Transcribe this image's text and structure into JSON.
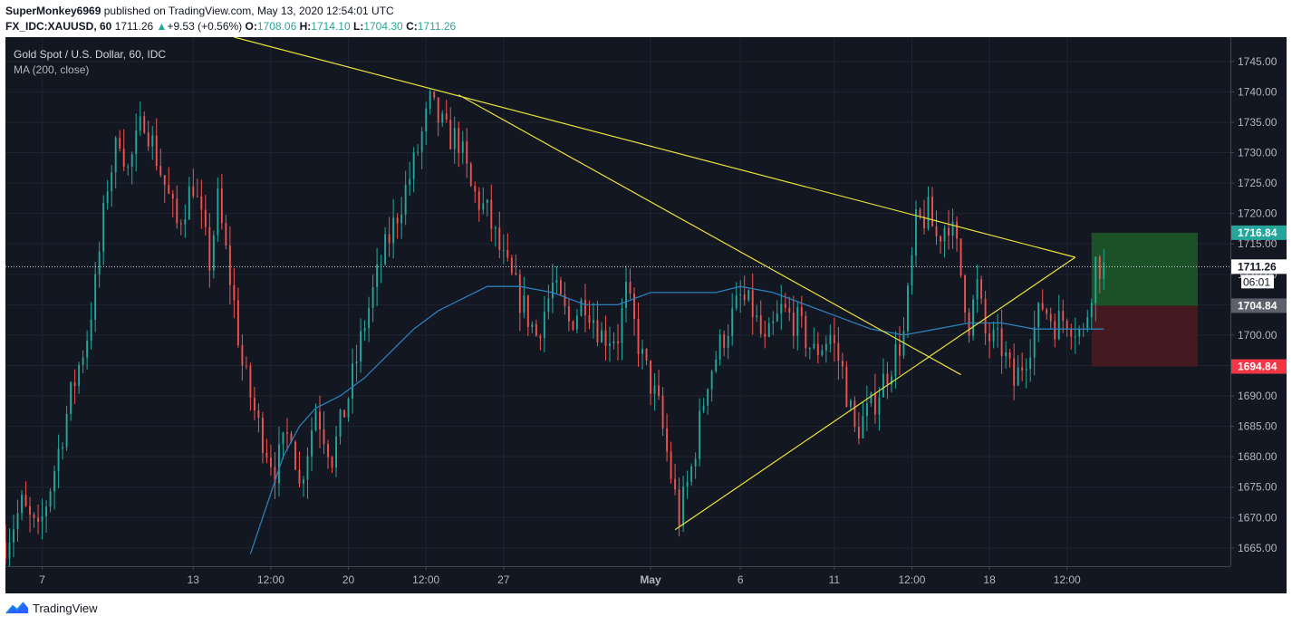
{
  "header": {
    "user": "SuperMonkey6969",
    "published": "published on TradingView.com, May 13, 2020 12:54:01 UTC",
    "symbol": "FX_IDC:XAUUSD, 60",
    "last": "1711.26",
    "change_arrow": "▲",
    "change": "+9.53 (+0.56%)",
    "open_label": "O:",
    "open": "1708.06",
    "high_label": "H:",
    "high": "1714.10",
    "low_label": "L:",
    "low": "1704.30",
    "close_label": "C:",
    "close": "1711.26"
  },
  "legend": {
    "title": "Gold Spot / U.S. Dollar, 60, IDC",
    "indicator": "MA (200, close)"
  },
  "footer": {
    "brand": "TradingView",
    "icon": "tradingview-logo-icon"
  },
  "colors": {
    "background": "#131722",
    "up": "#26a69a",
    "down": "#ef5350",
    "ma": "#2e7eb8",
    "trendline": "#e8e23a",
    "target_zone": "#1e5a28",
    "stop_zone": "#4a1a20",
    "grid": "#1f2430"
  },
  "chart_data": {
    "type": "candlestick",
    "title": "Gold Spot / U.S. Dollar, 60, IDC",
    "timeframe": "60",
    "ylim": [
      1662,
      1749
    ],
    "y_ticks": [
      1665,
      1670,
      1675,
      1680,
      1685,
      1690,
      1695,
      1700,
      1705,
      1710,
      1715,
      1720,
      1725,
      1730,
      1735,
      1740,
      1745
    ],
    "y_tick_labels": [
      "1665.00",
      "1670.00",
      "1675.00",
      "1680.00",
      "1685.00",
      "1690.00",
      "1695.00",
      "1700.00",
      "1705.00",
      "1710.00",
      "1715.00",
      "1720.00",
      "1725.00",
      "1730.00",
      "1735.00",
      "1740.00",
      "1745.00"
    ],
    "x_tick_labels": [
      "7",
      "13",
      "12:00",
      "20",
      "12:00",
      "27",
      "May",
      "6",
      "11",
      "12:00",
      "18",
      "12:00"
    ],
    "bar_index_range": [
      0,
      300
    ],
    "x_tick_bars": [
      9,
      46,
      65,
      84,
      103,
      122,
      158,
      180,
      203,
      222,
      241,
      260
    ],
    "price_swings": [
      [
        0,
        1666
      ],
      [
        4,
        1672
      ],
      [
        8,
        1667
      ],
      [
        12,
        1678
      ],
      [
        16,
        1690
      ],
      [
        20,
        1700
      ],
      [
        22,
        1708
      ],
      [
        25,
        1725
      ],
      [
        28,
        1733
      ],
      [
        30,
        1727
      ],
      [
        34,
        1736
      ],
      [
        38,
        1727
      ],
      [
        42,
        1718
      ],
      [
        46,
        1725
      ],
      [
        50,
        1712
      ],
      [
        52,
        1722
      ],
      [
        56,
        1705
      ],
      [
        58,
        1695
      ],
      [
        62,
        1685
      ],
      [
        66,
        1678
      ],
      [
        70,
        1685
      ],
      [
        72,
        1675
      ],
      [
        76,
        1688
      ],
      [
        80,
        1680
      ],
      [
        84,
        1690
      ],
      [
        88,
        1702
      ],
      [
        92,
        1712
      ],
      [
        96,
        1720
      ],
      [
        100,
        1728
      ],
      [
        104,
        1738
      ],
      [
        108,
        1733
      ],
      [
        111,
        1732
      ],
      [
        114,
        1724
      ],
      [
        118,
        1720
      ],
      [
        122,
        1712
      ],
      [
        126,
        1706
      ],
      [
        130,
        1700
      ],
      [
        134,
        1708
      ],
      [
        138,
        1702
      ],
      [
        142,
        1706
      ],
      [
        146,
        1700
      ],
      [
        150,
        1700
      ],
      [
        152,
        1707
      ],
      [
        156,
        1696
      ],
      [
        160,
        1688
      ],
      [
        163,
        1677
      ],
      [
        165,
        1670
      ],
      [
        168,
        1678
      ],
      [
        172,
        1693
      ],
      [
        176,
        1700
      ],
      [
        180,
        1706
      ],
      [
        183,
        1704
      ],
      [
        186,
        1698
      ],
      [
        190,
        1704
      ],
      [
        194,
        1702
      ],
      [
        198,
        1697
      ],
      [
        202,
        1700
      ],
      [
        205,
        1694
      ],
      [
        208,
        1684
      ],
      [
        212,
        1688
      ],
      [
        216,
        1694
      ],
      [
        220,
        1700
      ],
      [
        223,
        1718
      ],
      [
        226,
        1720
      ],
      [
        228,
        1716
      ],
      [
        231,
        1719
      ],
      [
        233,
        1714
      ],
      [
        236,
        1702
      ],
      [
        238,
        1708
      ],
      [
        240,
        1700
      ],
      [
        244,
        1698
      ],
      [
        247,
        1692
      ],
      [
        250,
        1697
      ],
      [
        254,
        1705
      ],
      [
        257,
        1702
      ],
      [
        260,
        1703
      ],
      [
        264,
        1700
      ],
      [
        267,
        1712
      ],
      [
        269,
        1711
      ]
    ],
    "moving_average": {
      "name": "MA (200, close)",
      "points": [
        [
          60,
          1664
        ],
        [
          64,
          1672
        ],
        [
          68,
          1680
        ],
        [
          72,
          1685
        ],
        [
          76,
          1688
        ],
        [
          82,
          1690
        ],
        [
          88,
          1693
        ],
        [
          94,
          1697
        ],
        [
          100,
          1701
        ],
        [
          106,
          1704
        ],
        [
          112,
          1706
        ],
        [
          118,
          1708
        ],
        [
          126,
          1708
        ],
        [
          134,
          1707
        ],
        [
          142,
          1705
        ],
        [
          150,
          1705
        ],
        [
          158,
          1707
        ],
        [
          166,
          1707
        ],
        [
          174,
          1707
        ],
        [
          180,
          1708
        ],
        [
          188,
          1707
        ],
        [
          196,
          1705
        ],
        [
          204,
          1703
        ],
        [
          212,
          1701
        ],
        [
          220,
          1700
        ],
        [
          228,
          1701
        ],
        [
          236,
          1702
        ],
        [
          244,
          1702
        ],
        [
          252,
          1701
        ],
        [
          260,
          1701
        ],
        [
          269,
          1701
        ]
      ]
    },
    "trendlines": [
      {
        "name": "upper-resistance",
        "points": [
          [
            56,
            1749
          ],
          [
            262,
            1712.8
          ]
        ]
      },
      {
        "name": "inner-resistance",
        "points": [
          [
            111,
            1739.5
          ],
          [
            234,
            1693.5
          ]
        ]
      },
      {
        "name": "lower-support",
        "points": [
          [
            164,
            1668
          ],
          [
            262,
            1712.8
          ]
        ]
      }
    ],
    "position": {
      "start_bar": 266,
      "end_bar": 292,
      "target": 1716.84,
      "entry": 1704.84,
      "stop": 1694.84
    },
    "current_price": 1711.26,
    "countdown": "06:01",
    "price_labels": [
      {
        "value": 1716.84,
        "text": "1716.84",
        "bg": "#26a69a",
        "fg": "#ffffff"
      },
      {
        "value": 1711.26,
        "text": "1711.26",
        "bg": "#ffffff",
        "fg": "#131722"
      },
      {
        "value": 1704.84,
        "text": "1704.84",
        "bg": "#5d606b",
        "fg": "#ffffff"
      },
      {
        "value": 1694.84,
        "text": "1694.84",
        "bg": "#f23645",
        "fg": "#ffffff"
      }
    ]
  }
}
